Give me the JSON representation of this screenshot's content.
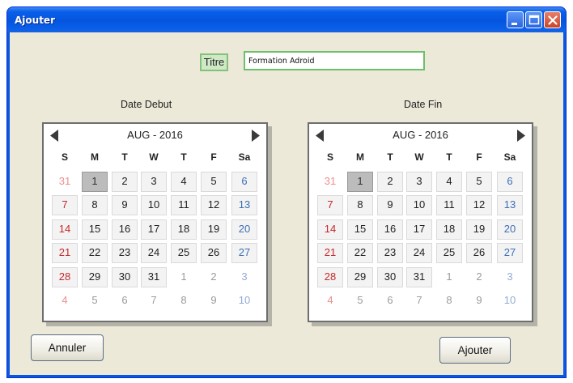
{
  "window": {
    "title": "Ajouter"
  },
  "form": {
    "titre_label": "Titre",
    "titre_value": "Formation Adroid"
  },
  "calendars": [
    {
      "label": "Date Debut",
      "month": "AUG - 2016"
    },
    {
      "label": "Date Fin",
      "month": "AUG - 2016"
    }
  ],
  "weekdays": [
    "S",
    "M",
    "T",
    "W",
    "T",
    "F",
    "Sa"
  ],
  "weeks": [
    [
      "31",
      "1",
      "2",
      "3",
      "4",
      "5",
      "6"
    ],
    [
      "7",
      "8",
      "9",
      "10",
      "11",
      "12",
      "13"
    ],
    [
      "14",
      "15",
      "16",
      "17",
      "18",
      "19",
      "20"
    ],
    [
      "21",
      "22",
      "23",
      "24",
      "25",
      "26",
      "27"
    ],
    [
      "28",
      "29",
      "30",
      "31",
      "1",
      "2",
      "3"
    ],
    [
      "4",
      "5",
      "6",
      "7",
      "8",
      "9",
      "10"
    ]
  ],
  "selected_day": "1",
  "buttons": {
    "cancel": "Annuler",
    "submit": "Ajouter"
  },
  "colors": {
    "sunday": "#c7282b",
    "saturday": "#3e6fb6",
    "selected": "#bcbcbc",
    "titlebar": "#0a5ee8",
    "title_highlight": "#cfe9c5"
  },
  "icons": {
    "minimize": "minimize-icon",
    "maximize": "maximize-icon",
    "close": "close-icon",
    "prev": "triangle-left-icon",
    "next": "triangle-right-icon"
  }
}
